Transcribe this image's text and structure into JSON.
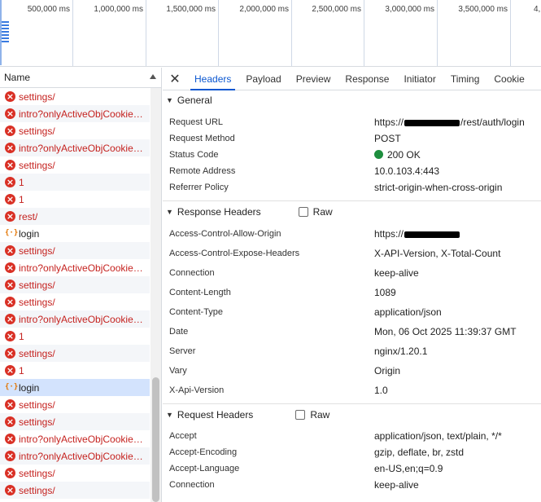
{
  "timeline": {
    "ticks": [
      "500,000 ms",
      "1,000,000 ms",
      "1,500,000 ms",
      "2,000,000 ms",
      "2,500,000 ms",
      "3,000,000 ms",
      "3,500,000 ms",
      "4,("
    ]
  },
  "list": {
    "header": "Name",
    "rows": [
      {
        "name": "settings/",
        "icon": "error-icon"
      },
      {
        "name": "intro?onlyActiveObjCookie…",
        "icon": "error-icon"
      },
      {
        "name": "settings/",
        "icon": "error-icon"
      },
      {
        "name": "intro?onlyActiveObjCookie…",
        "icon": "error-icon"
      },
      {
        "name": "settings/",
        "icon": "error-icon"
      },
      {
        "name": "1",
        "icon": "error-icon"
      },
      {
        "name": "1",
        "icon": "error-icon"
      },
      {
        "name": "rest/",
        "icon": "error-icon"
      },
      {
        "name": "login",
        "icon": "fetch-icon"
      },
      {
        "name": "settings/",
        "icon": "error-icon"
      },
      {
        "name": "intro?onlyActiveObjCookie…",
        "icon": "error-icon"
      },
      {
        "name": "settings/",
        "icon": "error-icon"
      },
      {
        "name": "settings/",
        "icon": "error-icon"
      },
      {
        "name": "intro?onlyActiveObjCookie…",
        "icon": "error-icon"
      },
      {
        "name": "1",
        "icon": "error-icon"
      },
      {
        "name": "settings/",
        "icon": "error-icon"
      },
      {
        "name": "1",
        "icon": "error-icon"
      },
      {
        "name": "login",
        "icon": "fetch-icon",
        "selected": true
      },
      {
        "name": "settings/",
        "icon": "error-icon"
      },
      {
        "name": "settings/",
        "icon": "error-icon"
      },
      {
        "name": "intro?onlyActiveObjCookie…",
        "icon": "error-icon"
      },
      {
        "name": "intro?onlyActiveObjCookie…",
        "icon": "error-icon"
      },
      {
        "name": "settings/",
        "icon": "error-icon"
      },
      {
        "name": "settings/",
        "icon": "error-icon"
      }
    ]
  },
  "tabs": [
    "Headers",
    "Payload",
    "Preview",
    "Response",
    "Initiator",
    "Timing",
    "Cookie"
  ],
  "active_tab": "Headers",
  "general": {
    "title": "General",
    "rows": [
      {
        "key": "Request URL",
        "value_prefix": "https://",
        "value_suffix": "/rest/auth/login",
        "redacted": true
      },
      {
        "key": "Request Method",
        "value": "POST"
      },
      {
        "key": "Status Code",
        "value": "200 OK",
        "status_color": "#1e8e3e"
      },
      {
        "key": "Remote Address",
        "value": "10.0.103.4:443"
      },
      {
        "key": "Referrer Policy",
        "value": "strict-origin-when-cross-origin"
      }
    ]
  },
  "response_headers": {
    "title": "Response Headers",
    "raw_label": "Raw",
    "rows": [
      {
        "key": "Access-Control-Allow-Origin",
        "value_prefix": "https://",
        "redacted": true
      },
      {
        "key": "Access-Control-Expose-Headers",
        "value": "X-API-Version, X-Total-Count"
      },
      {
        "key": "Connection",
        "value": "keep-alive"
      },
      {
        "key": "Content-Length",
        "value": "1089"
      },
      {
        "key": "Content-Type",
        "value": "application/json"
      },
      {
        "key": "Date",
        "value": "Mon, 06 Oct 2025 11:39:37 GMT"
      },
      {
        "key": "Server",
        "value": "nginx/1.20.1"
      },
      {
        "key": "Vary",
        "value": "Origin"
      },
      {
        "key": "X-Api-Version",
        "value": "1.0"
      }
    ]
  },
  "request_headers": {
    "title": "Request Headers",
    "raw_label": "Raw",
    "rows": [
      {
        "key": "Accept",
        "value": "application/json, text/plain, */*"
      },
      {
        "key": "Accept-Encoding",
        "value": "gzip, deflate, br, zstd"
      },
      {
        "key": "Accept-Language",
        "value": "en-US,en;q=0.9"
      },
      {
        "key": "Connection",
        "value": "keep-alive"
      }
    ]
  },
  "colors": {
    "error": "#d93025",
    "accent": "#0b57d0",
    "selected_row": "#d3e3fd",
    "status_ok": "#1e8e3e"
  }
}
